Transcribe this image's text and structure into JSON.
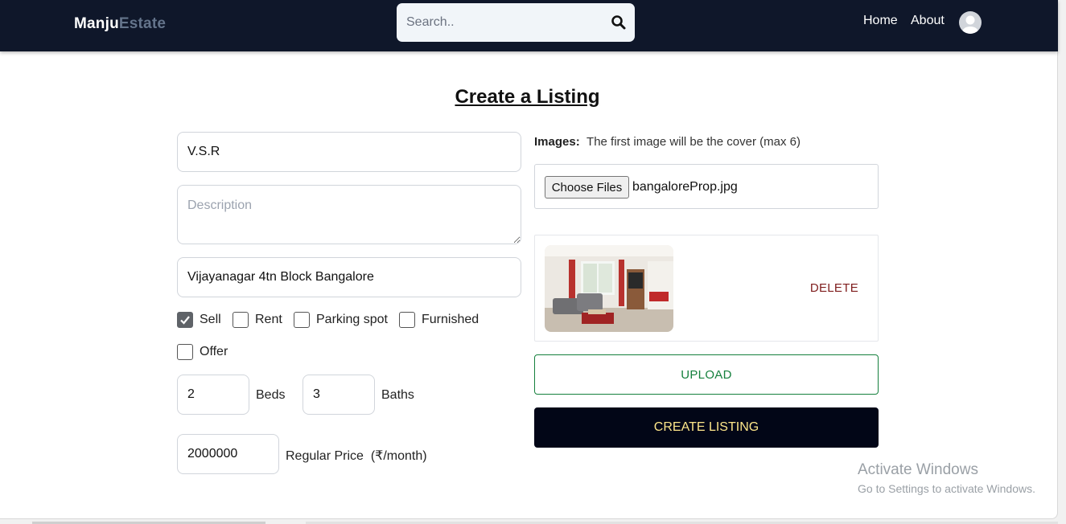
{
  "navbar": {
    "logo_primary": "Manju",
    "logo_secondary": "Estate",
    "search_placeholder": "Search..",
    "links": [
      "Home",
      "About"
    ]
  },
  "form": {
    "title": "Create a Listing",
    "name_value": "V.S.R",
    "description_placeholder": "Description",
    "address_value": "Vijayanagar 4tn Block Bangalore",
    "checkboxes": [
      {
        "label": "Sell",
        "checked": true
      },
      {
        "label": "Rent",
        "checked": false
      },
      {
        "label": "Parking spot",
        "checked": false
      },
      {
        "label": "Furnished",
        "checked": false
      },
      {
        "label": "Offer",
        "checked": false
      }
    ],
    "beds_value": "2",
    "beds_label": "Beds",
    "baths_value": "3",
    "baths_label": "Baths",
    "price_value": "2000000",
    "price_label": "Regular Price",
    "price_unit": "(₹/month)"
  },
  "images": {
    "label_bold": "Images:",
    "label_text": "The first image will be the cover (max 6)",
    "choose_button": "Choose Files",
    "file_name": "bangaloreProp.jpg",
    "delete_label": "DELETE",
    "upload_label": "UPLOAD",
    "create_label": "CREATE LISTING"
  },
  "watermark": {
    "line1": "Activate Windows",
    "line2": "Go to Settings to activate Windows."
  },
  "colors": {
    "navbar_bg": "#0f172a",
    "upload_green": "#15803d",
    "delete_red": "#7f1d1d",
    "create_bg": "#020617"
  }
}
